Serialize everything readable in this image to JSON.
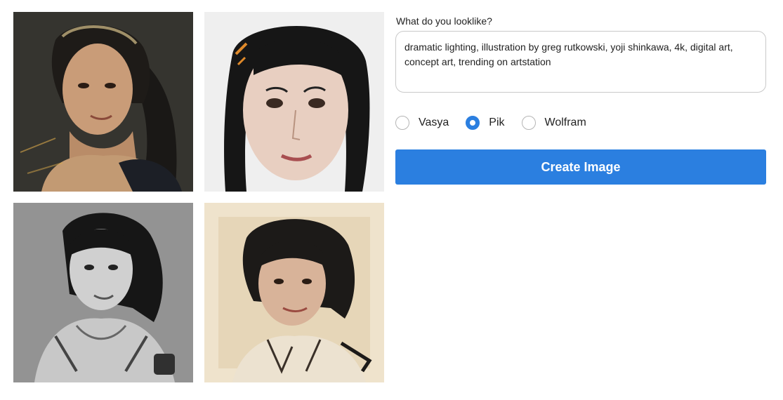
{
  "gallery": {
    "images": [
      {
        "name": "portrait-color-painterly"
      },
      {
        "name": "portrait-closeup-light"
      },
      {
        "name": "portrait-grayscale-armor"
      },
      {
        "name": "portrait-sepia-sketch"
      }
    ]
  },
  "form": {
    "prompt_label": "What do you looklike?",
    "prompt_value": "dramatic lighting, illustration by greg rutkowski, yoji shinkawa, 4k, digital art, concept art, trending on artstation",
    "options": [
      {
        "label": "Vasya",
        "checked": false
      },
      {
        "label": "Pik",
        "checked": true
      },
      {
        "label": "Wolfram",
        "checked": false
      }
    ],
    "submit_label": "Create Image"
  },
  "colors": {
    "accent": "#2b7fe0",
    "border": "#c9c9c9"
  }
}
